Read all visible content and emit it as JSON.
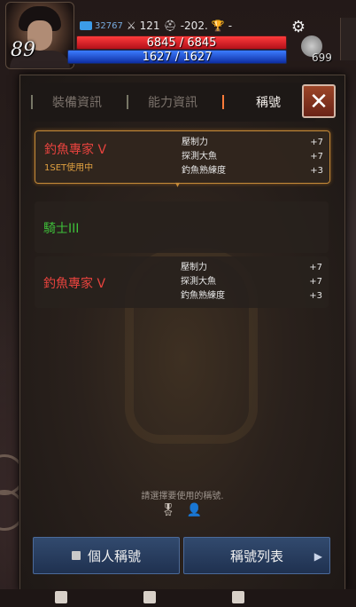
{
  "hud": {
    "level": "89",
    "exp_value": "32767",
    "attack_value": "121",
    "defense_value": "-202.",
    "trophy_text": "-",
    "hp_text": "6845 / 6845",
    "mp_text": "1627 / 1627",
    "bag_count": "699"
  },
  "tabs": [
    {
      "label": "裝備資訊",
      "active": false
    },
    {
      "label": "能力資訊",
      "active": false
    },
    {
      "label": "稱號",
      "active": true
    }
  ],
  "titles": [
    {
      "name": "釣魚專家 V",
      "status": "1SET使用中",
      "color": "#e8433e",
      "stats": [
        {
          "label": "壓制力",
          "value": "+7"
        },
        {
          "label": "探測大魚",
          "value": "+7"
        },
        {
          "label": "釣魚熟練度",
          "value": "+3"
        }
      ]
    },
    {
      "name": "騎士III",
      "status": "",
      "color": "#3ec03a",
      "stats": []
    },
    {
      "name": "釣魚專家 V",
      "status": "",
      "color": "#e8433e",
      "stats": [
        {
          "label": "壓制力",
          "value": "+7"
        },
        {
          "label": "探測大魚",
          "value": "+7"
        },
        {
          "label": "釣魚熟練度",
          "value": "+3"
        }
      ]
    }
  ],
  "hint": "請選擇要使用的稱號.",
  "buttons": {
    "personal_title": "個人稱號",
    "title_list": "稱號列表"
  }
}
